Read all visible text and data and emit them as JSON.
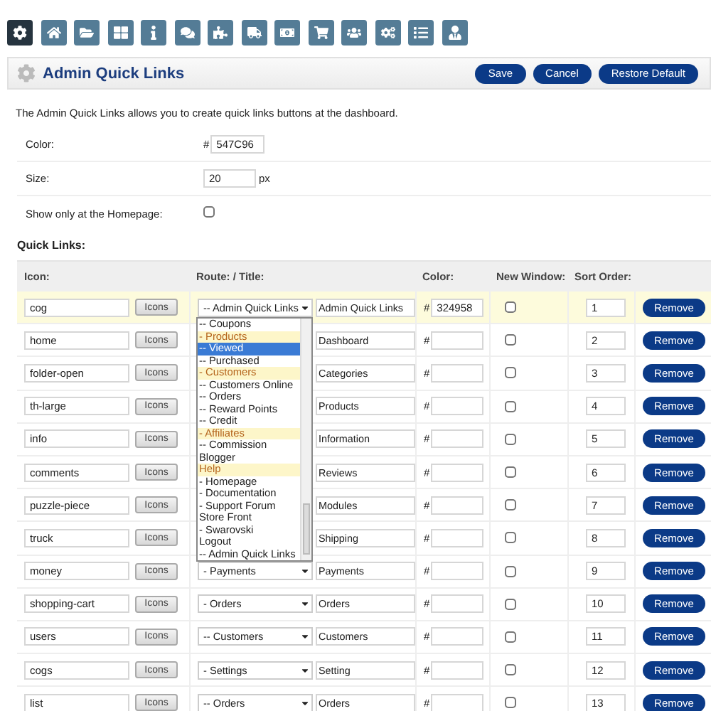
{
  "toolbar": [
    {
      "kind": "cog",
      "selected": true
    },
    {
      "kind": "home",
      "selected": false
    },
    {
      "kind": "folder",
      "selected": false
    },
    {
      "kind": "grid",
      "selected": false
    },
    {
      "kind": "info",
      "selected": false
    },
    {
      "kind": "comments",
      "selected": false
    },
    {
      "kind": "puzzle",
      "selected": false
    },
    {
      "kind": "truck",
      "selected": false
    },
    {
      "kind": "money",
      "selected": false
    },
    {
      "kind": "cart",
      "selected": false
    },
    {
      "kind": "users",
      "selected": false
    },
    {
      "kind": "cogs",
      "selected": false
    },
    {
      "kind": "list",
      "selected": false
    },
    {
      "kind": "user",
      "selected": false
    }
  ],
  "header": {
    "title": "Admin Quick Links",
    "buttons": [
      "Save",
      "Cancel",
      "Restore Default"
    ]
  },
  "description": "The Admin Quick Links allows you to create quick links buttons at the dashboard.",
  "settings": {
    "color": {
      "label": "Color:",
      "prefix": "#",
      "value": "547C96"
    },
    "size": {
      "label": "Size:",
      "value": "20",
      "unit": "px"
    },
    "homepage_only": {
      "label": "Show only at the Homepage:",
      "checked": false
    }
  },
  "quick_links": {
    "title": "Quick Links:",
    "columns": [
      "Icon:",
      "Route: / Title:",
      "Color:",
      "New Window:",
      "Sort Order:"
    ],
    "rows": [
      {
        "icon": "cog",
        "icons_button": "Icons",
        "route": "-- Admin Quick Links",
        "title": "Admin Quick Links",
        "color_prefix": "#",
        "color_value": "324958",
        "new_window": false,
        "sort_order": "1",
        "remove": "Remove",
        "selected": true
      },
      {
        "icon": "home",
        "icons_button": "Icons",
        "title": "Dashboard",
        "color_prefix": "#",
        "new_window": false,
        "sort_order": "2",
        "remove": "Remove",
        "selected": false
      },
      {
        "icon": "folder-open",
        "icons_button": "Icons",
        "title": "Categories",
        "color_prefix": "#",
        "new_window": false,
        "sort_order": "3",
        "remove": "Remove",
        "selected": false
      },
      {
        "icon": "th-large",
        "icons_button": "Icons",
        "title": "Products",
        "color_prefix": "#",
        "new_window": false,
        "sort_order": "4",
        "remove": "Remove",
        "selected": false
      },
      {
        "icon": "info",
        "icons_button": "Icons",
        "title": "Information",
        "color_prefix": "#",
        "new_window": false,
        "sort_order": "5",
        "remove": "Remove",
        "selected": false
      },
      {
        "icon": "comments",
        "icons_button": "Icons",
        "title": "Reviews",
        "color_prefix": "#",
        "new_window": false,
        "sort_order": "6",
        "remove": "Remove",
        "selected": false
      },
      {
        "icon": "puzzle-piece",
        "icons_button": "Icons",
        "title": "Modules",
        "color_prefix": "#",
        "new_window": false,
        "sort_order": "7",
        "remove": "Remove",
        "selected": false
      },
      {
        "icon": "truck",
        "icons_button": "Icons",
        "title": "Shipping",
        "color_prefix": "#",
        "new_window": false,
        "sort_order": "8",
        "remove": "Remove",
        "selected": false
      },
      {
        "icon": "money",
        "icons_button": "Icons",
        "route": "- Payments",
        "title": "Payments",
        "color_prefix": "#",
        "new_window": false,
        "sort_order": "9",
        "remove": "Remove",
        "selected": false
      },
      {
        "icon": "shopping-cart",
        "icons_button": "Icons",
        "route": "- Orders",
        "title": "Orders",
        "color_prefix": "#",
        "new_window": false,
        "sort_order": "10",
        "remove": "Remove",
        "selected": false
      },
      {
        "icon": "users",
        "icons_button": "Icons",
        "route": "-- Customers",
        "title": "Customers",
        "color_prefix": "#",
        "new_window": false,
        "sort_order": "11",
        "remove": "Remove",
        "selected": false
      },
      {
        "icon": "cogs",
        "icons_button": "Icons",
        "route": "- Settings",
        "title": "Setting",
        "color_prefix": "#",
        "new_window": false,
        "sort_order": "12",
        "remove": "Remove",
        "selected": false
      },
      {
        "icon": "list",
        "icons_button": "Icons",
        "route": "-- Orders",
        "title": "Orders",
        "color_prefix": "#",
        "new_window": false,
        "sort_order": "13",
        "remove": "Remove",
        "selected": false
      }
    ],
    "route_dropdown": [
      {
        "label": "-- Coupons",
        "kind": "item",
        "selected": false
      },
      {
        "label": "- Products",
        "kind": "category",
        "selected": false
      },
      {
        "label": "-- Viewed",
        "kind": "item",
        "selected": true
      },
      {
        "label": "-- Purchased",
        "kind": "item",
        "selected": false
      },
      {
        "label": "- Customers",
        "kind": "category",
        "selected": false
      },
      {
        "label": "-- Customers Online",
        "kind": "item",
        "selected": false
      },
      {
        "label": "-- Orders",
        "kind": "item",
        "selected": false
      },
      {
        "label": "-- Reward Points",
        "kind": "item",
        "selected": false
      },
      {
        "label": "-- Credit",
        "kind": "item",
        "selected": false
      },
      {
        "label": "- Affiliates",
        "kind": "category",
        "selected": false
      },
      {
        "label": "-- Commission",
        "kind": "item",
        "selected": false
      },
      {
        "label": "Blogger",
        "kind": "item",
        "selected": false
      },
      {
        "label": "Help",
        "kind": "category",
        "selected": false
      },
      {
        "label": "- Homepage",
        "kind": "item",
        "selected": false
      },
      {
        "label": "- Documentation",
        "kind": "item",
        "selected": false
      },
      {
        "label": "- Support Forum",
        "kind": "item",
        "selected": false
      },
      {
        "label": "Store Front",
        "kind": "item",
        "selected": false
      },
      {
        "label": "- Swarovski",
        "kind": "item",
        "selected": false
      },
      {
        "label": "Logout",
        "kind": "item",
        "selected": false
      },
      {
        "label": "-- Admin Quick Links",
        "kind": "item",
        "selected": false
      }
    ]
  }
}
